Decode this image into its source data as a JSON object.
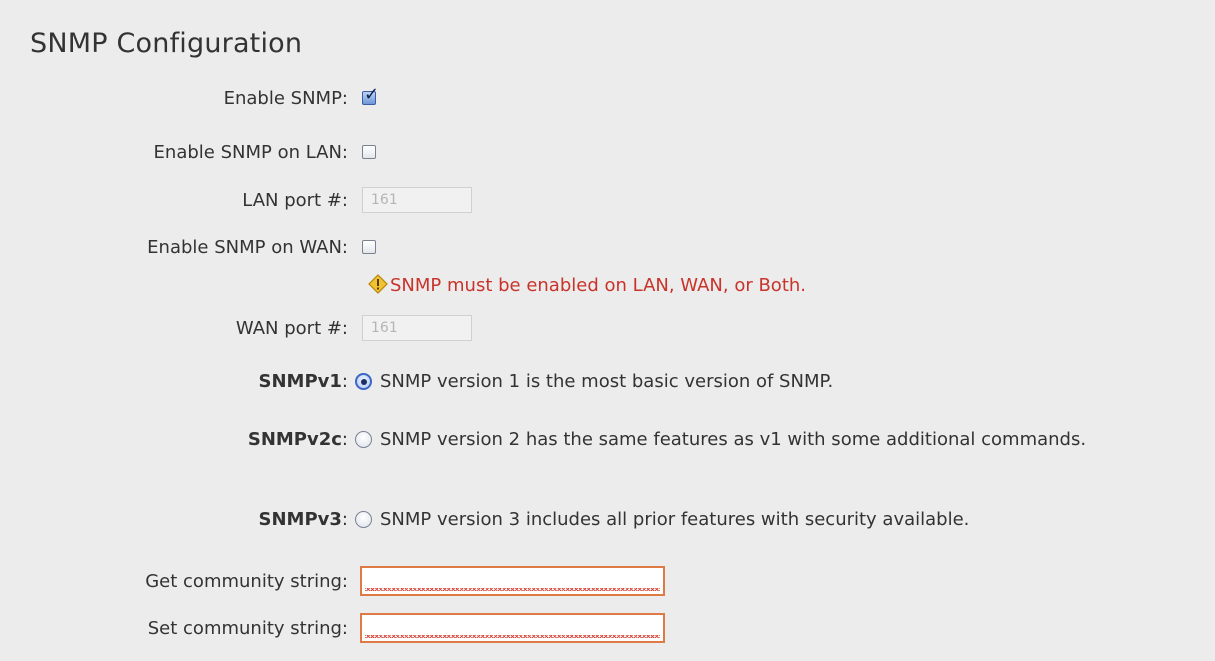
{
  "form": {
    "title": "SNMP Configuration",
    "enable_snmp": {
      "label": "Enable SNMP:",
      "checked": true
    },
    "enable_lan": {
      "label": "Enable SNMP on LAN:",
      "checked": false
    },
    "lan_port": {
      "label": "LAN port #:",
      "value": "161"
    },
    "enable_wan": {
      "label": "Enable SNMP on WAN:",
      "checked": false
    },
    "warning": {
      "icon": "warning-icon",
      "text": "SNMP must be enabled on LAN, WAN, or Both."
    },
    "wan_port": {
      "label": "WAN port #:",
      "value": "161"
    },
    "versions": [
      {
        "label": "SNMPv1",
        "text": "SNMP version 1 is the most basic version of SNMP.",
        "selected": true
      },
      {
        "label": "SNMPv2c",
        "text": "SNMP version 2 has the same features as v1 with some additional commands.",
        "selected": false
      },
      {
        "label": "SNMPv3",
        "text": "SNMP version 3 includes all prior features with security available.",
        "selected": false
      }
    ],
    "colon": ":",
    "get_community": {
      "label": "Get community string:",
      "value": ""
    },
    "set_community": {
      "label": "Set community string:",
      "value": ""
    }
  },
  "colors": {
    "background": "#ececec",
    "warning": "#c8332a",
    "error_border": "#e07a45",
    "accent": "#3c66c4"
  }
}
